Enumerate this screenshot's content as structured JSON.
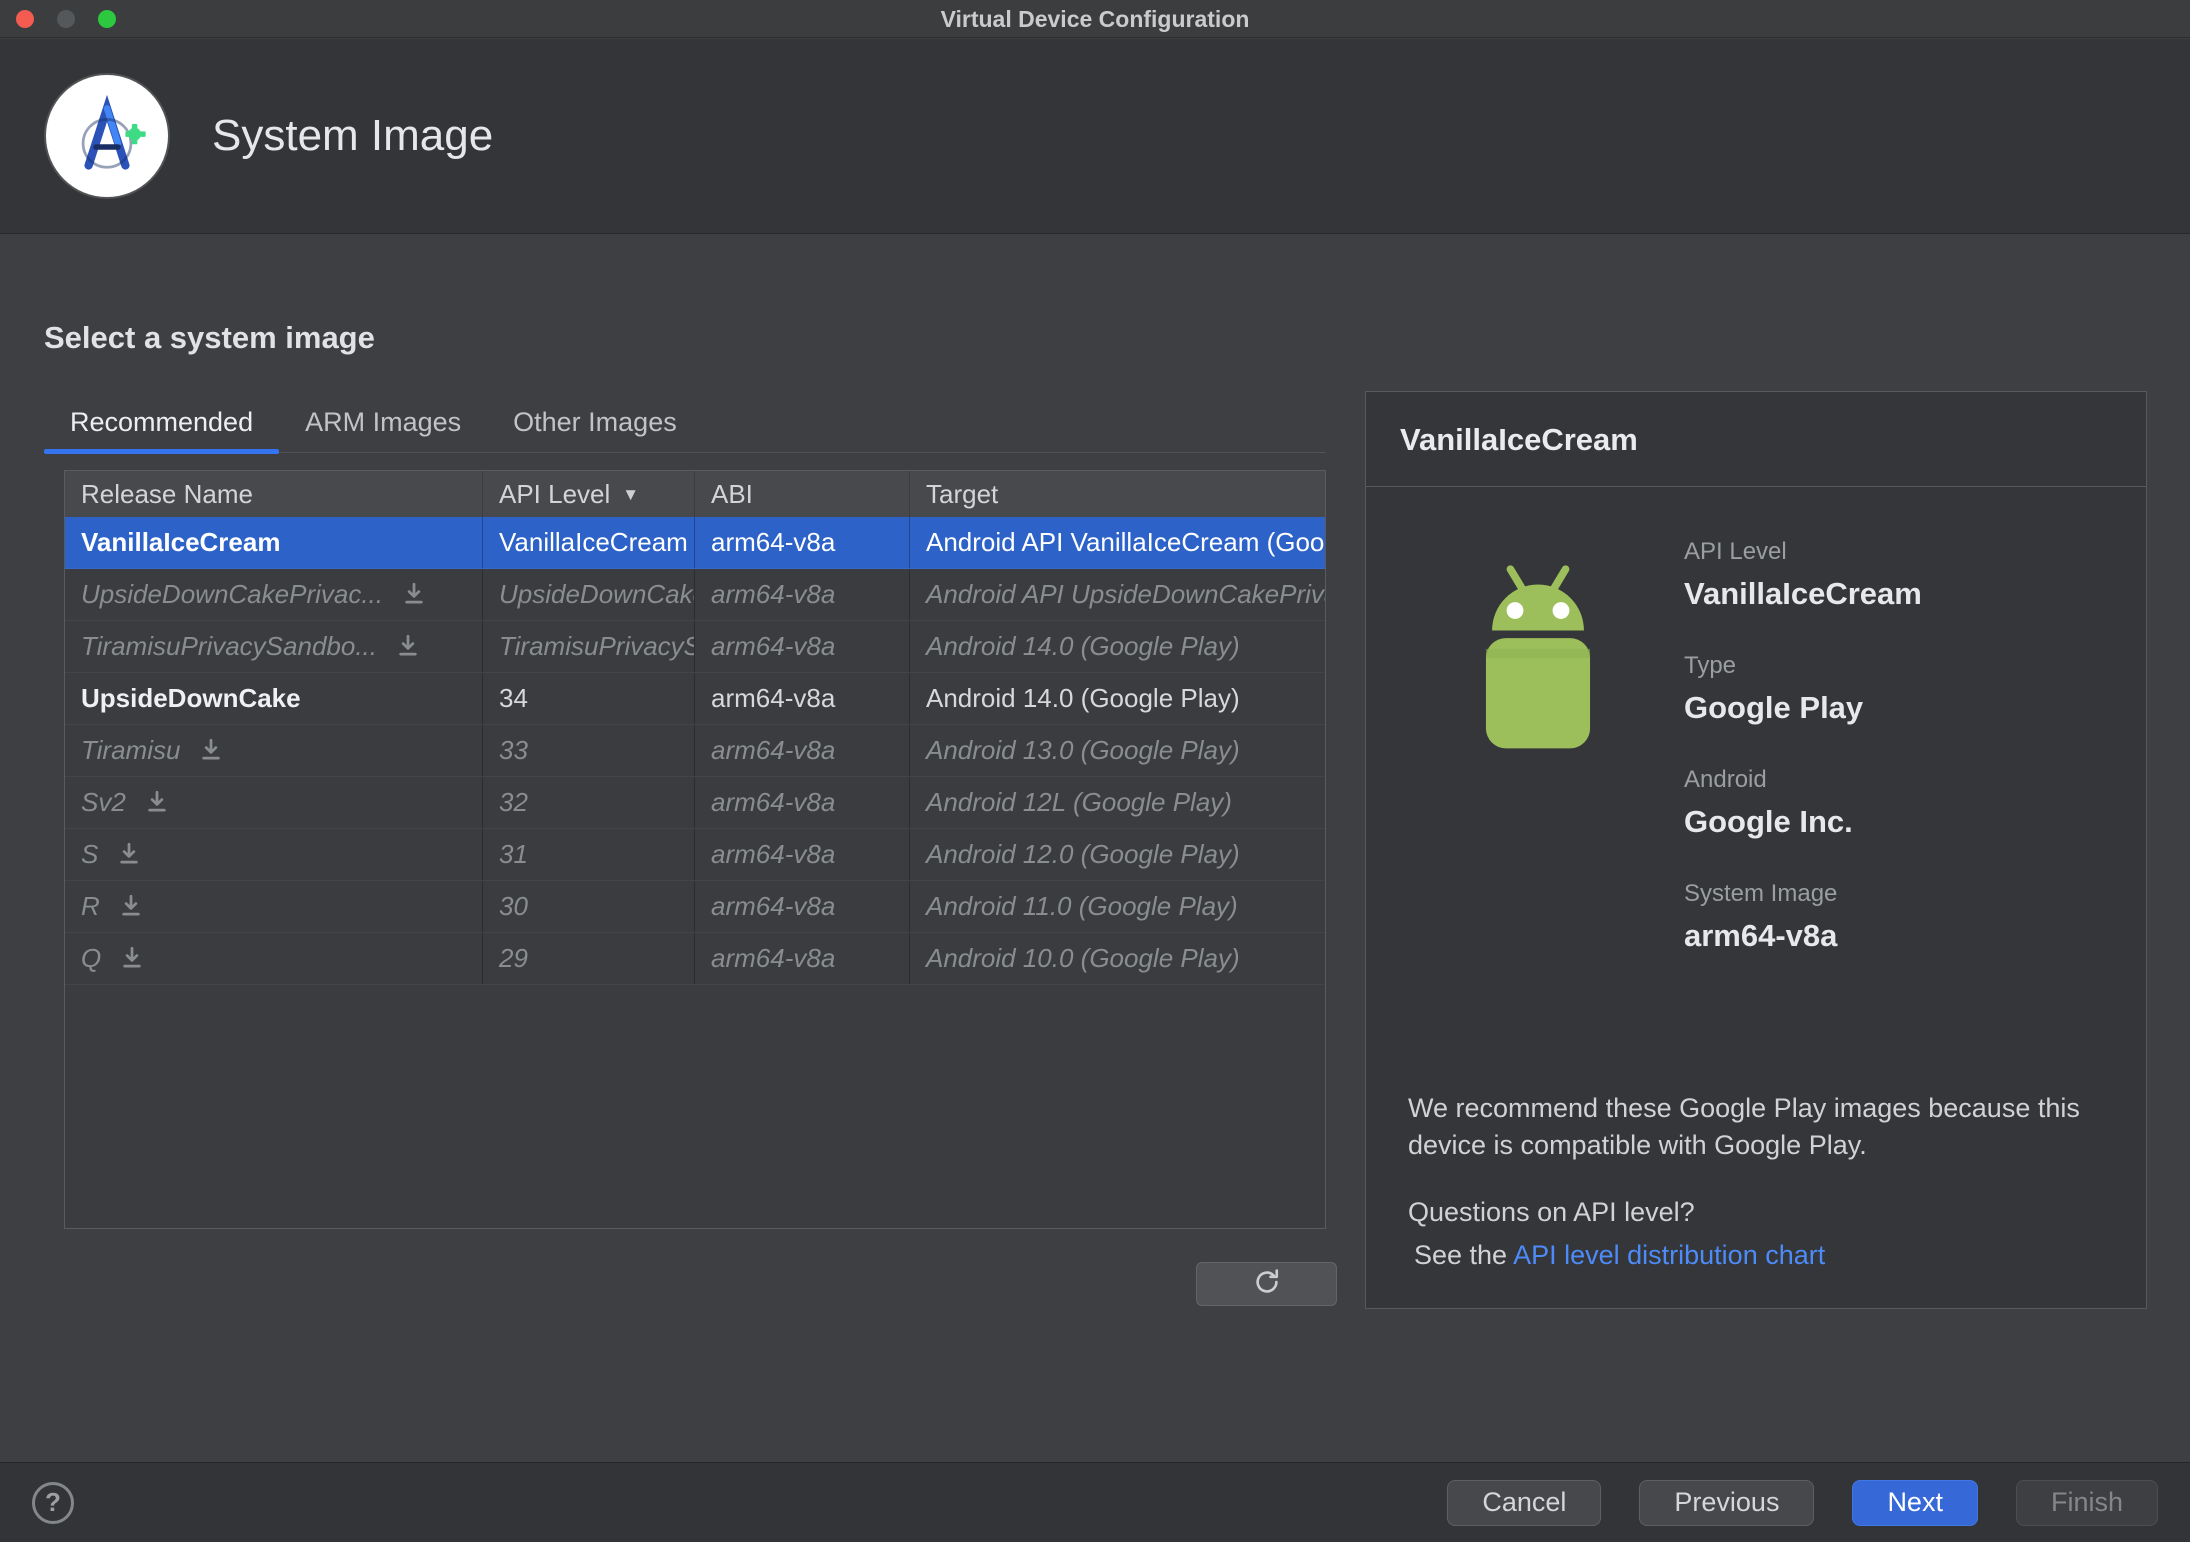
{
  "window": {
    "title": "Virtual Device Configuration"
  },
  "header": {
    "title": "System Image"
  },
  "main": {
    "section_title": "Select a system image",
    "tabs": [
      {
        "label": "Recommended",
        "active": true
      },
      {
        "label": "ARM Images",
        "active": false
      },
      {
        "label": "Other Images",
        "active": false
      }
    ],
    "table": {
      "columns": [
        "Release Name",
        "API Level",
        "ABI",
        "Target"
      ],
      "sort_column": "API Level",
      "sort_arrow": "▼",
      "rows": [
        {
          "release": "VanillaIceCream",
          "api": "VanillaIceCream",
          "abi": "arm64-v8a",
          "target": "Android API VanillaIceCream (Google Play)",
          "selected": true,
          "download": false
        },
        {
          "release": "UpsideDownCakePrivac...",
          "api": "UpsideDownCakePrivacySandbox",
          "abi": "arm64-v8a",
          "target": "Android API UpsideDownCakePrivacySandbox (Google Play)",
          "selected": false,
          "download": true
        },
        {
          "release": "TiramisuPrivacySandbo...",
          "api": "TiramisuPrivacySandbox",
          "abi": "arm64-v8a",
          "target": "Android 14.0 (Google Play)",
          "selected": false,
          "download": true
        },
        {
          "release": "UpsideDownCake",
          "api": "34",
          "abi": "arm64-v8a",
          "target": "Android 14.0 (Google Play)",
          "selected": false,
          "download": false
        },
        {
          "release": "Tiramisu",
          "api": "33",
          "abi": "arm64-v8a",
          "target": "Android 13.0 (Google Play)",
          "selected": false,
          "download": true
        },
        {
          "release": "Sv2",
          "api": "32",
          "abi": "arm64-v8a",
          "target": "Android 12L (Google Play)",
          "selected": false,
          "download": true
        },
        {
          "release": "S",
          "api": "31",
          "abi": "arm64-v8a",
          "target": "Android 12.0 (Google Play)",
          "selected": false,
          "download": true
        },
        {
          "release": "R",
          "api": "30",
          "abi": "arm64-v8a",
          "target": "Android 11.0 (Google Play)",
          "selected": false,
          "download": true
        },
        {
          "release": "Q",
          "api": "29",
          "abi": "arm64-v8a",
          "target": "Android 10.0 (Google Play)",
          "selected": false,
          "download": true
        }
      ]
    }
  },
  "details": {
    "title": "VanillaIceCream",
    "fields": [
      {
        "label": "API Level",
        "value": "VanillaIceCream"
      },
      {
        "label": "Type",
        "value": "Google Play"
      },
      {
        "label": "Android",
        "value": "Google Inc."
      },
      {
        "label": "System Image",
        "value": "arm64-v8a"
      }
    ],
    "recommendation": "We recommend these Google Play images because this device is compatible with Google Play.",
    "question": "Questions on API level?",
    "see_the": "See the ",
    "link": "API level distribution chart"
  },
  "footer": {
    "help_glyph": "?",
    "buttons": [
      {
        "label": "Cancel"
      },
      {
        "label": "Previous"
      },
      {
        "label": "Next"
      },
      {
        "label": "Finish"
      }
    ]
  },
  "colors": {
    "accent_blue": "#3574f0",
    "selection_blue": "#2d63c8",
    "link_blue": "#4d8bf8",
    "android_green": "#9cbf5b"
  }
}
